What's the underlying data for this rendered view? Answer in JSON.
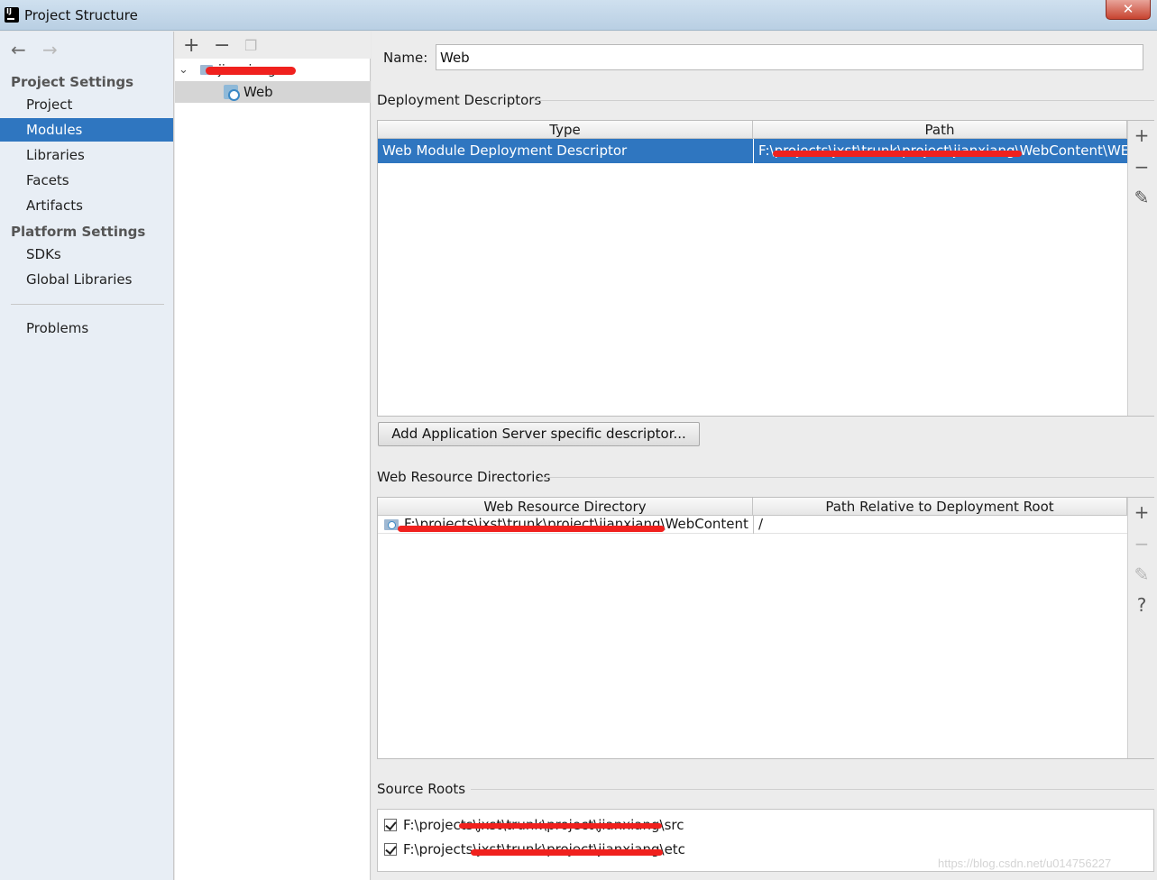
{
  "window": {
    "title": "Project Structure",
    "close_glyph": "✕"
  },
  "nav": {
    "back_icon": "←",
    "forward_icon": "→",
    "project_settings_heading": "Project Settings",
    "project_items": [
      "Project",
      "Modules",
      "Libraries",
      "Facets",
      "Artifacts"
    ],
    "platform_settings_heading": "Platform Settings",
    "platform_items": [
      "SDKs",
      "Global Libraries"
    ],
    "problems": "Problems",
    "selected": "Modules"
  },
  "tree": {
    "toolbar": {
      "add_icon": "+",
      "remove_icon": "−",
      "copy_icon": "❐"
    },
    "module_name": "jianxiang",
    "facet_label": "Web",
    "expand_icon": "⌄"
  },
  "main": {
    "name_label": "Name:",
    "name_value": "Web",
    "deployment": {
      "title": "Deployment Descriptors",
      "columns": [
        "Type",
        "Path"
      ],
      "rows": [
        {
          "type": "Web Module Deployment Descriptor",
          "path": "F:\\projects\\jxst\\trunk\\project\\jianxiang\\WebContent\\WE"
        }
      ],
      "side_icons": {
        "add": "+",
        "remove": "−",
        "edit": "✎"
      },
      "add_button": "Add Application Server specific descriptor..."
    },
    "web_resources": {
      "title": "Web Resource Directories",
      "columns": [
        "Web Resource Directory",
        "Path Relative to Deployment Root"
      ],
      "rows": [
        {
          "directory": "F:\\projects\\jxst\\trunk\\project\\jianxiang\\WebContent",
          "relative": "/"
        }
      ],
      "side_icons": {
        "add": "+",
        "remove": "−",
        "edit": "✎",
        "help": "?"
      }
    },
    "source_roots": {
      "title": "Source Roots",
      "rows": [
        {
          "path": "F:\\projects\\jxst\\trunk\\project\\jianxiang\\src",
          "checked": true
        },
        {
          "path": "F:\\projects\\jxst\\trunk\\project\\jianxiang\\etc",
          "checked": true
        }
      ]
    }
  },
  "watermark": "https://blog.csdn.net/u014756227",
  "colors": {
    "selection": "#2f76c0",
    "redaction": "#f0211e",
    "title_bar": "#c3d6e8"
  }
}
